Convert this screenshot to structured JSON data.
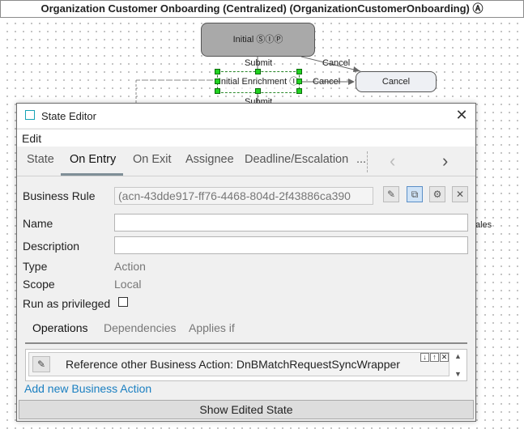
{
  "canvas": {
    "title": "Organization Customer Onboarding (Centralized) (OrganizationCustomerOnboarding) Ⓐ",
    "nodes": {
      "initial": "Initial ⓈⒾⓅ",
      "enrichment": "Initial Enrichment Ⓘ",
      "cancel": "Cancel"
    },
    "edge_labels": {
      "submit_top": "Submit",
      "cancel_top": "Cancel",
      "cancel_mid": "Cancel",
      "submit_bottom": "Submit"
    },
    "partial_text": "ales"
  },
  "dialog": {
    "title": "State Editor",
    "close_glyph": "✕",
    "menu": {
      "edit": "Edit"
    },
    "tabs": [
      "State",
      "On Entry",
      "On Exit",
      "Assignee",
      "Deadline/Escalation",
      "..."
    ],
    "active_tab": "On Entry",
    "nav": {
      "prev": "‹",
      "next": "›"
    },
    "form": {
      "business_rule_label": "Business Rule",
      "business_rule_value": "(acn-43dde917-ff76-4468-804d-2f43886ca390",
      "name_label": "Name",
      "name_value": "",
      "description_label": "Description",
      "description_value": "",
      "type_label": "Type",
      "type_value": "Action",
      "scope_label": "Scope",
      "scope_value": "Local",
      "run_priv_label": "Run as privileged",
      "run_priv_checked": false
    },
    "subtabs": [
      "Operations",
      "Dependencies",
      "Applies if"
    ],
    "operations": [
      {
        "text": "Reference other Business Action: DnBMatchRequestSyncWrapper"
      }
    ],
    "add_link": "Add new Business Action",
    "show_edited": "Show Edited State"
  }
}
